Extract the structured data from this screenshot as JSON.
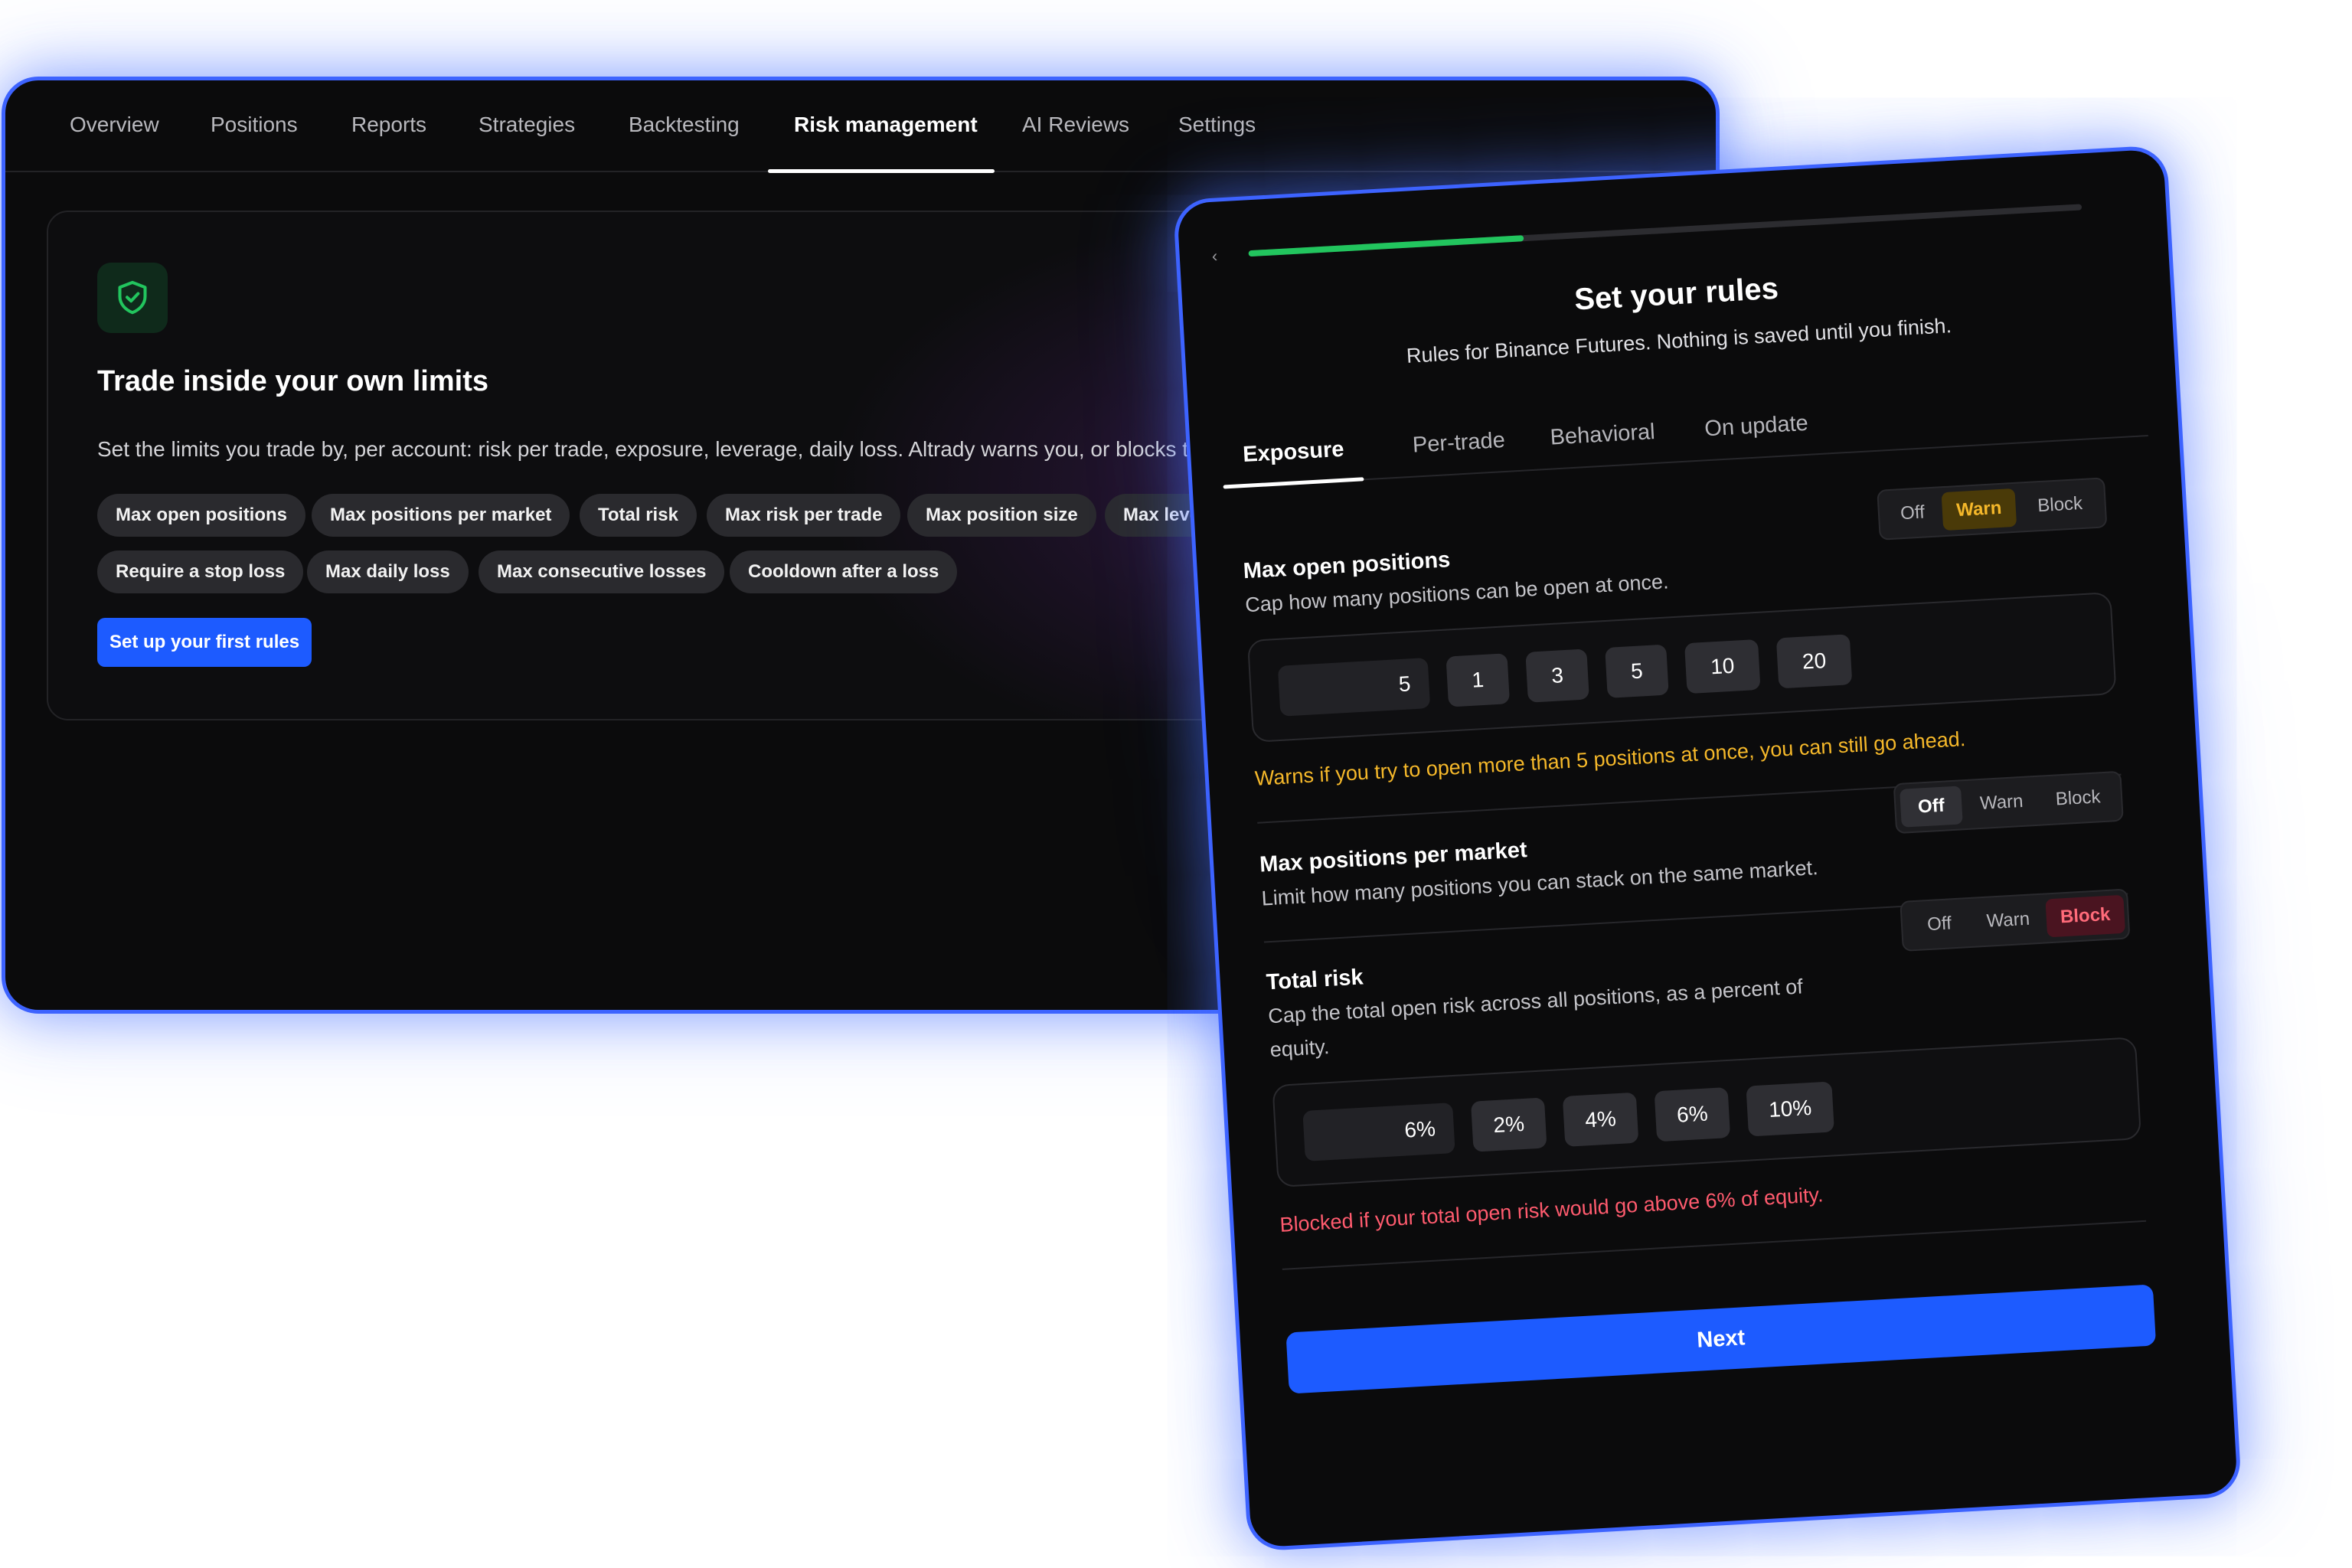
{
  "nav": {
    "tabs": [
      {
        "label": "Overview"
      },
      {
        "label": "Positions"
      },
      {
        "label": "Reports"
      },
      {
        "label": "Strategies"
      },
      {
        "label": "Backtesting"
      },
      {
        "label": "Risk management",
        "active": true
      },
      {
        "label": "AI Reviews"
      },
      {
        "label": "Settings"
      }
    ]
  },
  "intro": {
    "icon": "shield-check-icon",
    "title": "Trade inside your own limits",
    "description": "Set the limits you trade by, per account: risk per trade, exposure, leverage, daily loss. Altrady warns you, or blocks the order.",
    "chips": [
      "Max open positions",
      "Max positions per market",
      "Total risk",
      "Max risk per trade",
      "Max position size",
      "Max leverage",
      "Require a stop loss",
      "Max daily loss",
      "Max consecutive losses",
      "Cooldown after a loss"
    ],
    "cta_label": "Set up your first rules"
  },
  "wizard": {
    "back_glyph": "‹",
    "progress": 0.33,
    "title": "Set your rules",
    "subtitle": "Rules for Binance Futures. Nothing is saved until you finish.",
    "tabs": [
      {
        "label": "Exposure",
        "active": true
      },
      {
        "label": "Per-trade"
      },
      {
        "label": "Behavioral"
      },
      {
        "label": "On update"
      }
    ],
    "mode_options": [
      "Off",
      "Warn",
      "Block"
    ],
    "rules": [
      {
        "title": "Max open positions",
        "description": "Cap how many positions can be open at once.",
        "mode": "Warn",
        "value": "5",
        "presets": [
          "1",
          "3",
          "5",
          "10",
          "20"
        ],
        "message": "Warns if you try to open more than 5 positions at once, you can still go ahead."
      },
      {
        "title": "Max positions per market",
        "description": "Limit how many positions you can stack on the same market.",
        "mode": "Off"
      },
      {
        "title": "Total risk",
        "description": "Cap the total open risk across all positions, as a percent of equity.",
        "mode": "Block",
        "value": "6%",
        "presets": [
          "2%",
          "4%",
          "6%",
          "10%"
        ],
        "message": "Blocked if your total open risk would go above 6% of equity."
      }
    ],
    "next_label": "Next"
  },
  "colors": {
    "accent_blue": "#1d5bff",
    "frame_blue": "#3d63ff",
    "progress_green": "#22c55e",
    "warn_amber": "#f5b82a",
    "block_red": "#ff5b6e"
  }
}
